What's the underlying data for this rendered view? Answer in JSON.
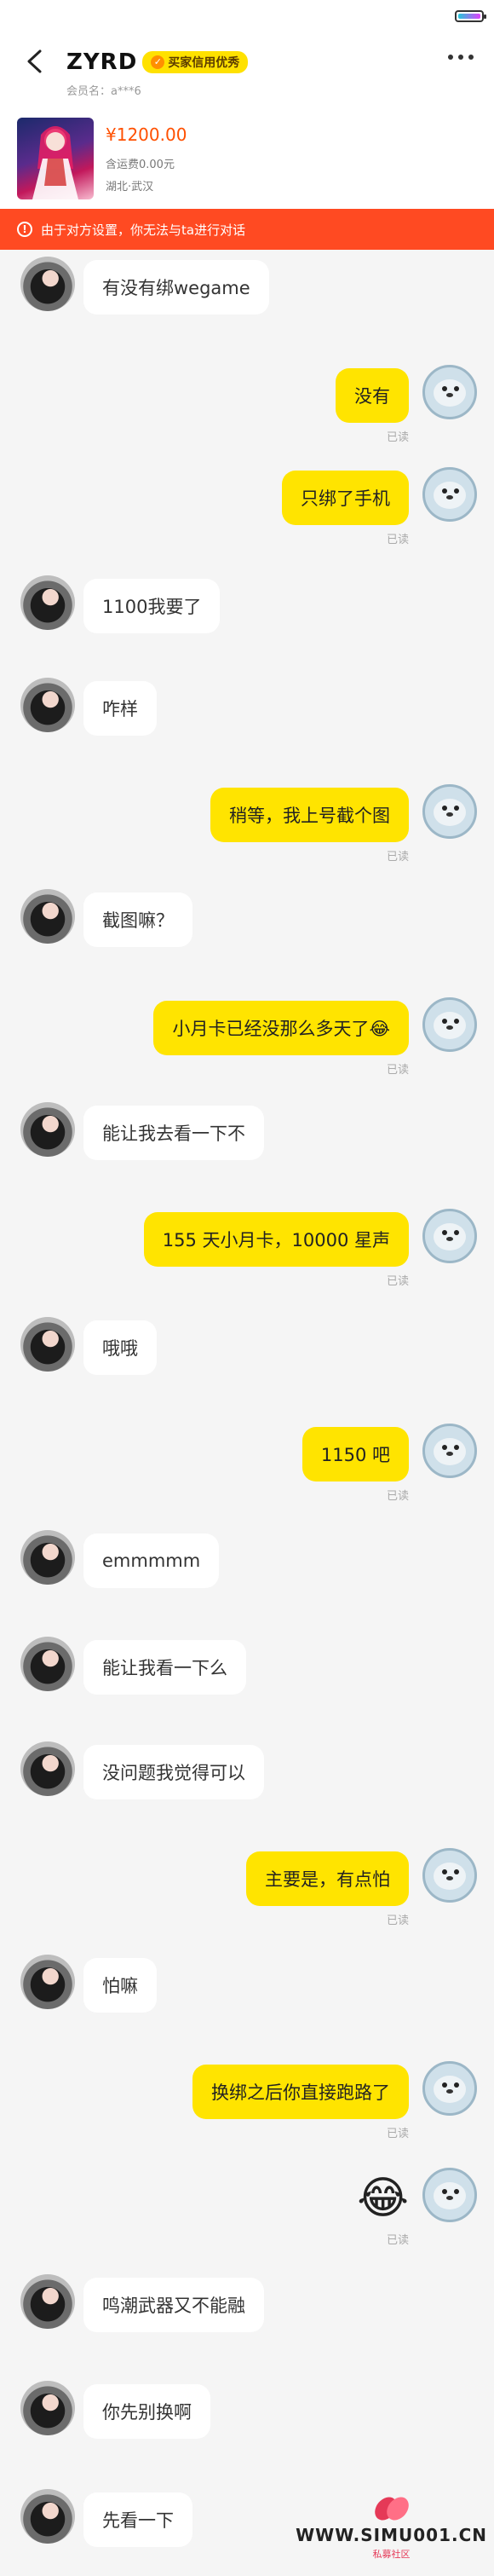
{
  "header": {
    "title": "ZYRD",
    "badge": "买家信用优秀",
    "member": "会员名：a***6"
  },
  "product": {
    "price": "¥1200.00",
    "freight": "含运费0.00元",
    "location": "湖北·武汉"
  },
  "notice": "由于对方设置，你无法与ta进行对话",
  "messages": [
    {
      "side": "left",
      "text": "有没有绑wegame"
    },
    {
      "side": "right",
      "text": "没有",
      "read": "已读"
    },
    {
      "side": "right",
      "text": "只绑了手机",
      "read": "已读"
    },
    {
      "side": "left",
      "text": "1100我要了"
    },
    {
      "side": "left",
      "text": "咋样"
    },
    {
      "side": "right",
      "text": "稍等，我上号截个图",
      "read": "已读"
    },
    {
      "side": "left",
      "text": "截图嘛？"
    },
    {
      "side": "right",
      "text": "小月卡已经没那么多天了😂",
      "read": "已读"
    },
    {
      "side": "left",
      "text": "能让我去看一下不"
    },
    {
      "side": "right",
      "text": "155 天小月卡，10000 星声",
      "read": "已读"
    },
    {
      "side": "left",
      "text": "哦哦"
    },
    {
      "side": "right",
      "text": "1150 吧",
      "read": "已读"
    },
    {
      "side": "left",
      "text": "emmmmm"
    },
    {
      "side": "left",
      "text": "能让我看一下么"
    },
    {
      "side": "left",
      "text": "没问题我觉得可以"
    },
    {
      "side": "right",
      "text": "主要是，有点怕",
      "read": "已读"
    },
    {
      "side": "left",
      "text": "怕嘛"
    },
    {
      "side": "right",
      "text": "换绑之后你直接跑路了",
      "read": "已读"
    },
    {
      "side": "right",
      "text": "😂",
      "read": "已读"
    },
    {
      "side": "left",
      "text": "鸣潮武器又不能融"
    },
    {
      "side": "left",
      "text": "你先别换啊"
    },
    {
      "side": "left",
      "text": "先看一下"
    }
  ],
  "watermark": {
    "text": "WWW.SIMU001.CN",
    "sub": "私募社区"
  }
}
